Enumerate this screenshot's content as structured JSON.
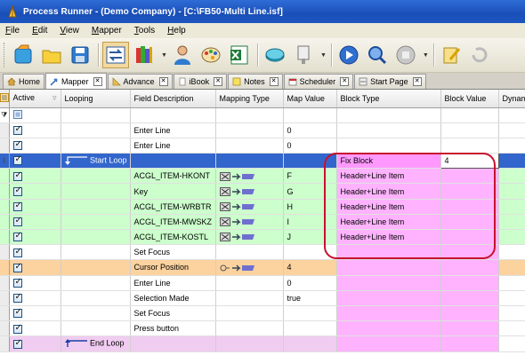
{
  "window": {
    "title": "Process Runner - (Demo Company) - [C:\\FB50-Multi Line.isf]"
  },
  "menu": [
    "File",
    "Edit",
    "View",
    "Mapper",
    "Tools",
    "Help"
  ],
  "tabs": [
    {
      "label": "Home",
      "icon": "home-icon",
      "active": false,
      "closable": false
    },
    {
      "label": "Mapper",
      "icon": "mapper-icon",
      "active": true,
      "closable": true
    },
    {
      "label": "Advance",
      "icon": "advance-icon",
      "active": false,
      "closable": true
    },
    {
      "label": "iBook",
      "icon": "ibook-icon",
      "active": false,
      "closable": true
    },
    {
      "label": "Notes",
      "icon": "notes-icon",
      "active": false,
      "closable": true
    },
    {
      "label": "Scheduler",
      "icon": "scheduler-icon",
      "active": false,
      "closable": true
    },
    {
      "label": "Start Page",
      "icon": "start-page-icon",
      "active": false,
      "closable": true
    }
  ],
  "columns": [
    "Active",
    "Looping",
    "Field Description",
    "Mapping Type",
    "Map Value",
    "Block Type",
    "Block Value",
    "Dynami"
  ],
  "rows": [
    {
      "style": "plain",
      "active": true,
      "looping": "",
      "field": "Enter Line",
      "mapping": "",
      "map_value": "0",
      "block_type": "",
      "block_value": ""
    },
    {
      "style": "plain",
      "active": true,
      "looping": "",
      "field": "Enter Line",
      "mapping": "",
      "map_value": "0",
      "block_type": "",
      "block_value": ""
    },
    {
      "style": "selected",
      "active": true,
      "looping": "Start Loop",
      "field": "",
      "mapping": "",
      "map_value": "",
      "block_type": "Fix Block",
      "block_value": "4"
    },
    {
      "style": "green",
      "active": true,
      "looping": "",
      "field": "ACGL_ITEM-HKONT",
      "mapping": "map",
      "map_value": "F",
      "block_type": "Header+Line Item",
      "block_value": ""
    },
    {
      "style": "green",
      "active": true,
      "looping": "",
      "field": "Key",
      "mapping": "map",
      "map_value": "G",
      "block_type": "Header+Line Item",
      "block_value": ""
    },
    {
      "style": "green",
      "active": true,
      "looping": "",
      "field": "ACGL_ITEM-WRBTR",
      "mapping": "map",
      "map_value": "H",
      "block_type": "Header+Line Item",
      "block_value": ""
    },
    {
      "style": "green",
      "active": true,
      "looping": "",
      "field": "ACGL_ITEM-MWSKZ",
      "mapping": "map",
      "map_value": "I",
      "block_type": "Header+Line Item",
      "block_value": ""
    },
    {
      "style": "green",
      "active": true,
      "looping": "",
      "field": "ACGL_ITEM-KOSTL",
      "mapping": "map",
      "map_value": "J",
      "block_type": "Header+Line Item",
      "block_value": ""
    },
    {
      "style": "plain-pink",
      "active": true,
      "looping": "",
      "field": "Set Focus",
      "mapping": "",
      "map_value": "",
      "block_type": "",
      "block_value": ""
    },
    {
      "style": "orange",
      "active": true,
      "looping": "",
      "field": "Cursor Position",
      "mapping": "map-key",
      "map_value": "4",
      "block_type": "",
      "block_value": ""
    },
    {
      "style": "plain-pink",
      "active": true,
      "looping": "",
      "field": "Enter Line",
      "mapping": "",
      "map_value": "0",
      "block_type": "",
      "block_value": ""
    },
    {
      "style": "plain-pink",
      "active": true,
      "looping": "",
      "field": "Selection Made",
      "mapping": "",
      "map_value": "true",
      "block_type": "",
      "block_value": ""
    },
    {
      "style": "plain-pink",
      "active": true,
      "looping": "",
      "field": "Set Focus",
      "mapping": "",
      "map_value": "",
      "block_type": "",
      "block_value": ""
    },
    {
      "style": "plain-pink",
      "active": true,
      "looping": "",
      "field": "Press button",
      "mapping": "",
      "map_value": "",
      "block_type": "",
      "block_value": ""
    },
    {
      "style": "endloop",
      "active": true,
      "looping": "End Loop",
      "field": "",
      "mapping": "",
      "map_value": "",
      "block_type": "",
      "block_value": ""
    }
  ],
  "colors": {
    "title_bar": "#1a4fb8",
    "selected_row": "#3366cc",
    "mapped_row": "#ccffcc",
    "cursor_row": "#fcd29f",
    "block_cell": "#ffb3ff",
    "callout": "#c8102e"
  }
}
